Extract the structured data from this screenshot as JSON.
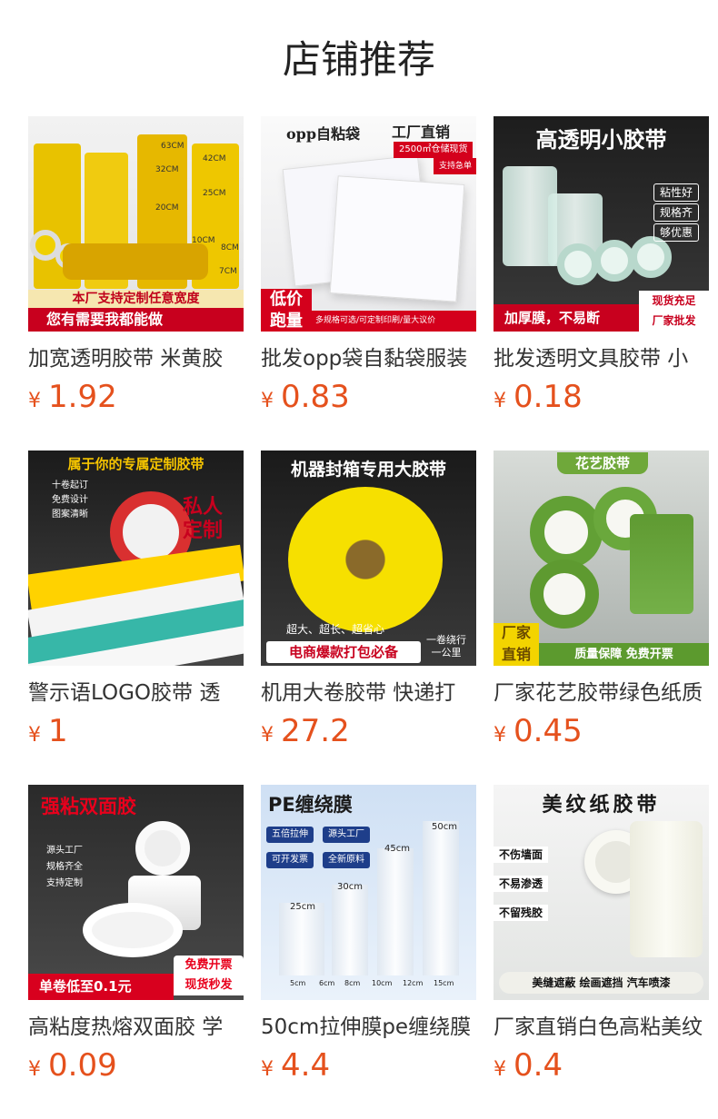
{
  "section_title": "店铺推荐",
  "currency_symbol": "¥",
  "price_color": "#e5511d",
  "products": [
    {
      "name": "加宽透明胶带 米黄胶",
      "price": "1.92",
      "image_text": {
        "banner_top": "本厂支持定制任意宽度",
        "banner_bottom": "您有需要我都能做",
        "sizes": [
          "63CM",
          "42CM",
          "32CM",
          "25CM",
          "20CM",
          "10CM",
          "8CM",
          "7CM"
        ]
      }
    },
    {
      "name": "批发opp袋自黏袋服装",
      "price": "0.83",
      "image_text": {
        "heading": "opp自粘袋",
        "factory": "工厂直销",
        "stock": "2500㎡仓储现货",
        "delivery": "支持急单",
        "badge_line1": "低价",
        "badge_line2": "跑量",
        "footer": "多规格可选/可定制印刷/量大议价"
      }
    },
    {
      "name": "批发透明文具胶带 小",
      "price": "0.18",
      "image_text": {
        "heading": "高透明小胶带",
        "features": [
          "粘性好",
          "规格齐",
          "够优惠"
        ],
        "footer_left": "加厚膜，不易断",
        "footer_right_line1": "现货充足",
        "footer_right_line2": "厂家批发"
      }
    },
    {
      "name": "警示语LOGO胶带 透",
      "price": "1",
      "image_text": {
        "heading": "属于你的专属定制胶带",
        "bullets": [
          "十卷起订",
          "免费设计",
          "图案清晰"
        ],
        "stamp": "私人定制"
      }
    },
    {
      "name": "机用大卷胶带 快递打",
      "price": "27.2",
      "image_text": {
        "heading": "机器封箱专用大胶带",
        "tagline": "超大、超长、超省心",
        "footer": "电商爆款打包必备",
        "badge_line1": "一卷绕行",
        "badge_line2": "一公里"
      }
    },
    {
      "name": "厂家花艺胶带绿色纸质",
      "price": "0.45",
      "image_text": {
        "heading": "花艺胶带",
        "badge_line1": "厂家",
        "badge_line2": "直销",
        "footer": "质量保障  免费开票"
      }
    },
    {
      "name": "高粘度热熔双面胶 学",
      "price": "0.09",
      "image_text": {
        "heading": "强粘双面胶",
        "bullets": [
          "源头工厂",
          "规格齐全",
          "支持定制"
        ],
        "badge_line1": "免费开票",
        "badge_line2": "现货秒发",
        "footer": "单卷低至0.1元"
      }
    },
    {
      "name": "50cm拉伸膜pe缠绕膜",
      "price": "4.4",
      "image_text": {
        "heading": "PE缠绕膜",
        "tags": [
          "五倍拉伸",
          "源头工厂",
          "可开发票",
          "全新原料"
        ],
        "sizes": [
          "50cm",
          "45cm",
          "30cm",
          "25cm",
          "5cm",
          "6cm",
          "8cm",
          "10cm",
          "12cm",
          "15cm"
        ]
      }
    },
    {
      "name": "厂家直销白色高粘美纹",
      "price": "0.4",
      "image_text": {
        "heading": "美纹纸胶带",
        "features": [
          "不伤墙面",
          "不易渗透",
          "不留残胶"
        ],
        "footer": "美缝遮蔽 绘画遮挡 汽车喷漆"
      }
    }
  ]
}
